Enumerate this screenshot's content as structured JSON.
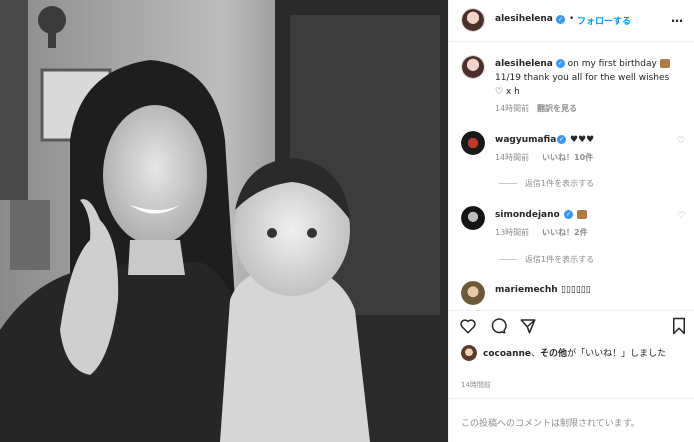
{
  "header": {
    "username": "alesihelena",
    "separator": "•",
    "follow": "フォローする",
    "more": "…"
  },
  "caption": {
    "username": "alesihelena",
    "line1": "on my first birthday",
    "line2": "11/19 thank you all for the well wishes",
    "line3": "♡ x h",
    "time": "14時間前",
    "translate": "翻訳を見る"
  },
  "comments": [
    {
      "username": "wagyumafia",
      "text": "♥♥♥",
      "time": "14時間前",
      "likes": "いいね！10件",
      "replies": "返信1件を表示する"
    },
    {
      "username": "simondejano",
      "text": "",
      "time": "13時間前",
      "likes": "いいね！2件",
      "replies": "返信1件を表示する"
    },
    {
      "username": "mariemechh",
      "text": "▯▯▯▯▯▯"
    }
  ],
  "likes": {
    "user": "cocoanne",
    "rest": "、その他",
    "suffix": "が「いいね！」しました",
    "bold_rest": "その他"
  },
  "post_time": "14時間前",
  "footer": {
    "disabled": "この投稿へのコメントは制限されています。"
  },
  "icons": [
    "heart-icon",
    "comment-icon",
    "share-icon",
    "bookmark-icon",
    "more-icon",
    "verified-icon",
    "cake-emoji-icon"
  ],
  "colors": {
    "accent": "#0095f6",
    "verified": "#3897f0",
    "muted": "#8e8e8e"
  }
}
